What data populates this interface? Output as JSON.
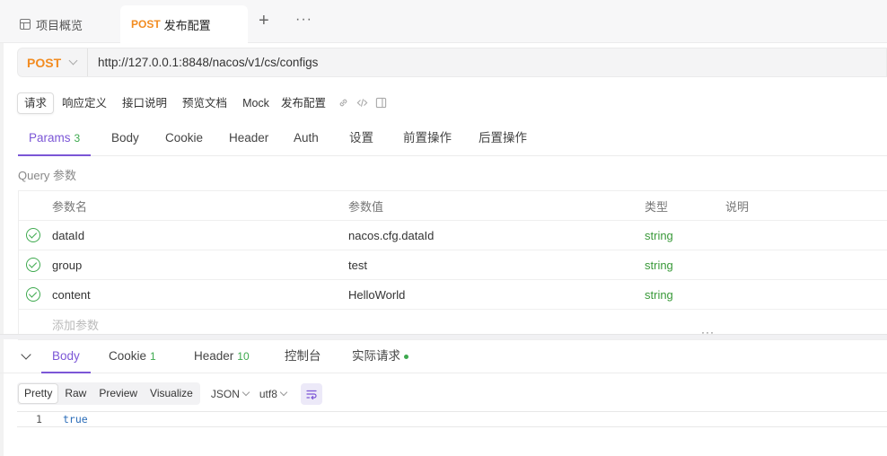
{
  "tabs": {
    "overview_label": "项目概览",
    "active_method": "POST",
    "active_label": "发布配置",
    "add_label": "+",
    "more_label": "···"
  },
  "request": {
    "method": "POST",
    "url": "http://127.0.0.1:8848/nacos/v1/cs/configs"
  },
  "subtabs": {
    "items": [
      "请求",
      "响应定义",
      "接口说明",
      "预览文档",
      "Mock"
    ],
    "title": "发布配置",
    "icons": [
      "link-icon",
      "code-icon",
      "panel-icon"
    ]
  },
  "param_tabs": [
    {
      "label": "Params",
      "count": "3"
    },
    {
      "label": "Body"
    },
    {
      "label": "Cookie"
    },
    {
      "label": "Header"
    },
    {
      "label": "Auth"
    },
    {
      "label": "设置"
    },
    {
      "label": "前置操作"
    },
    {
      "label": "后置操作"
    }
  ],
  "query": {
    "title": "Query 参数",
    "headers": {
      "name": "参数名",
      "value": "参数值",
      "type": "类型",
      "desc": "说明"
    },
    "rows": [
      {
        "name": "dataId",
        "value": "nacos.cfg.dataId",
        "type": "string",
        "desc": ""
      },
      {
        "name": "group",
        "value": "test",
        "type": "string",
        "desc": ""
      },
      {
        "name": "content",
        "value": "HelloWorld",
        "type": "string",
        "desc": ""
      }
    ],
    "add_placeholder": "添加参数"
  },
  "response_tabs": [
    {
      "label": "Body"
    },
    {
      "label": "Cookie",
      "count": "1"
    },
    {
      "label": "Header",
      "count": "10"
    },
    {
      "label": "控制台"
    },
    {
      "label": "实际请求"
    }
  ],
  "format": {
    "modes": [
      "Pretty",
      "Raw",
      "Preview",
      "Visualize"
    ],
    "language": "JSON",
    "encoding": "utf8"
  },
  "editor": {
    "lines": [
      {
        "no": "1",
        "text": "true"
      }
    ]
  },
  "colors": {
    "accent": "#7b56d6",
    "method": "#f28c21",
    "success": "#3da94e"
  }
}
